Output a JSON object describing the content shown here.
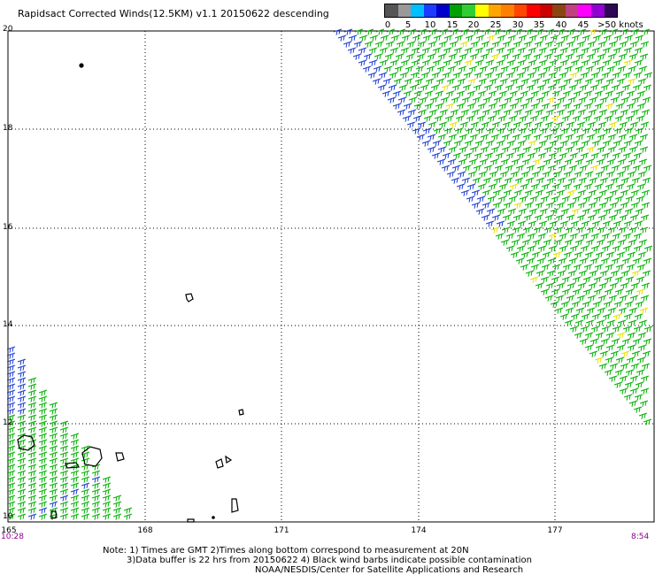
{
  "title": "Rapidsact Corrected Winds(12.5KM) v1.1 20150622 descending",
  "legend": {
    "colors": [
      "#555555",
      "#999999",
      "#00bfff",
      "#1e3cff",
      "#0000cd",
      "#00a000",
      "#32cd32",
      "#ffff00",
      "#ffa500",
      "#ff7f00",
      "#ff4500",
      "#ff0000",
      "#cc0000",
      "#8b4513",
      "#c04080",
      "#ff00ff",
      "#9400d3",
      "#2e0854"
    ],
    "ticks": [
      "0",
      "5",
      "10",
      "15",
      "20",
      "25",
      "30",
      "35",
      "40",
      "45",
      ">50 knots"
    ]
  },
  "axes": {
    "y_labels": [
      "20",
      "18",
      "16",
      "14",
      "12",
      "10"
    ],
    "x_labels": [
      "165",
      "168",
      "171",
      "174",
      "177"
    ]
  },
  "times": {
    "left": "10:28",
    "right": "8:54"
  },
  "notes": {
    "line1": "Note: 1) Times are GMT 2)Times along bottom correspond to measurement at 20N",
    "line2": "3)Data buffer is 22 hrs from 20150622 4) Black wind barbs indicate possible contamination",
    "line3": "NOAA/NESDIS/Center for Satellite Applications and Research"
  }
}
